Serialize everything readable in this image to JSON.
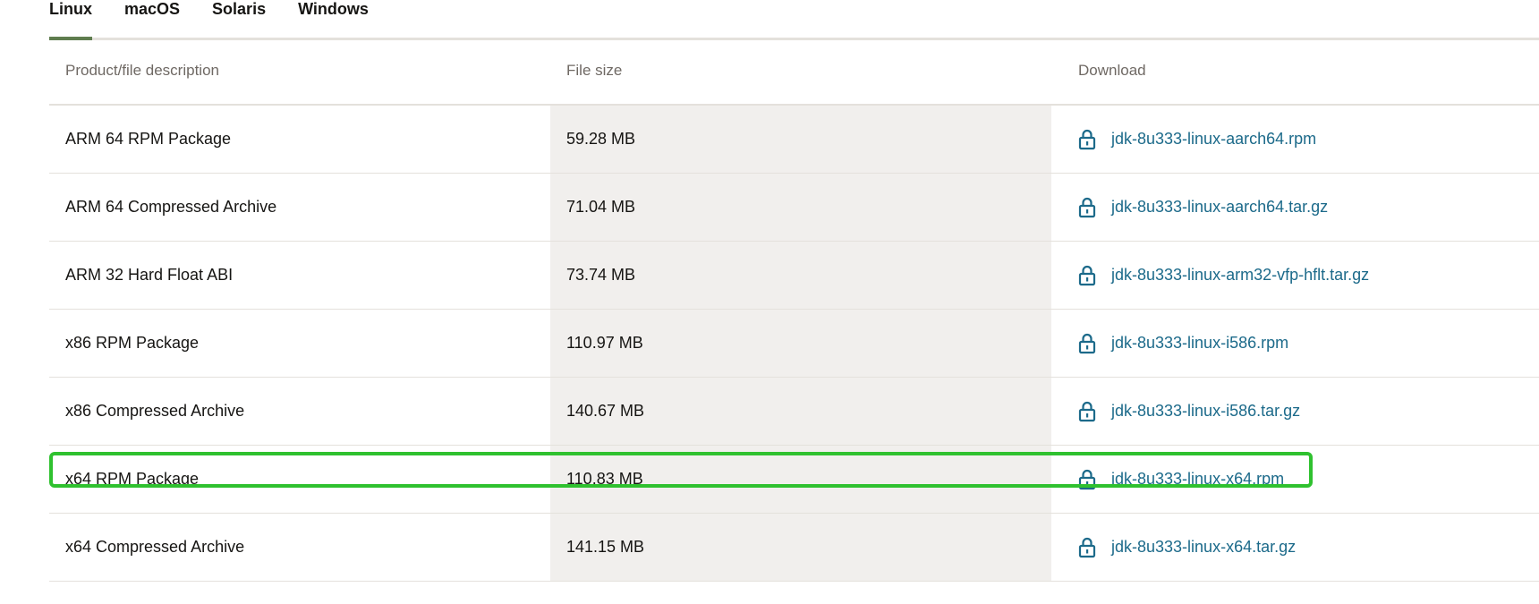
{
  "tabs": [
    {
      "label": "Linux",
      "active": true
    },
    {
      "label": "macOS",
      "active": false
    },
    {
      "label": "Solaris",
      "active": false
    },
    {
      "label": "Windows",
      "active": false
    }
  ],
  "table": {
    "headers": {
      "description": "Product/file description",
      "size": "File size",
      "download": "Download"
    },
    "rows": [
      {
        "description": "ARM 64 RPM Package",
        "size": "59.28 MB",
        "file": "jdk-8u333-linux-aarch64.rpm"
      },
      {
        "description": "ARM 64 Compressed Archive",
        "size": "71.04 MB",
        "file": "jdk-8u333-linux-aarch64.tar.gz"
      },
      {
        "description": "ARM 32 Hard Float ABI",
        "size": "73.74 MB",
        "file": "jdk-8u333-linux-arm32-vfp-hflt.tar.gz"
      },
      {
        "description": "x86 RPM Package",
        "size": "110.97 MB",
        "file": "jdk-8u333-linux-i586.rpm"
      },
      {
        "description": "x86 Compressed Archive",
        "size": "140.67 MB",
        "file": "jdk-8u333-linux-i586.tar.gz"
      },
      {
        "description": "x64 RPM Package",
        "size": "110.83 MB",
        "file": "jdk-8u333-linux-x64.rpm"
      },
      {
        "description": "x64 Compressed Archive",
        "size": "141.15 MB",
        "file": "jdk-8u333-linux-x64.tar.gz"
      }
    ]
  },
  "colors": {
    "active_tab_underline": "#5f7d4f",
    "link": "#1c6a8a",
    "highlight": "#2fc12f",
    "size_column_bg": "#f1efed"
  },
  "icons": {
    "download_link": "lock-icon"
  }
}
